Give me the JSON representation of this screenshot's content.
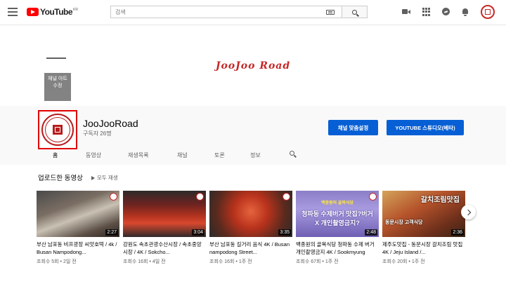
{
  "topbar": {
    "logo_text": "YouTube",
    "logo_region": "KR",
    "search_placeholder": "검색"
  },
  "banner": {
    "title": "JooJoo Road",
    "edit_art_label": "채널 아트 수정"
  },
  "channel": {
    "name": "JooJooRoad",
    "subscribers": "구독자 26명",
    "customize_button": "채널 맞춤설정",
    "studio_button": "YOUTUBE 스튜디오(베타)"
  },
  "tabs": [
    "홈",
    "동영상",
    "재생목록",
    "채널",
    "토론",
    "정보"
  ],
  "section": {
    "title": "업로드한 동영상",
    "play_all": "모두 재생"
  },
  "videos": [
    {
      "title": "부산 남포동 비프광장 씨앗호떡 / 4k / Busan Nampodong...",
      "meta": "조회수 5회 • 2일 전",
      "duration": "2:27"
    },
    {
      "title": "강원도 속초관광수산시장 / 속초중앙시장 / 4K / Sokcho...",
      "meta": "조회수 16회 • 4일 전",
      "duration": "3:04"
    },
    {
      "title": "부산 남포동 길거리 음식 4K / Busan nampodong Street...",
      "meta": "조회수 16회 • 1주 전",
      "duration": "3:35"
    },
    {
      "title": "백종원의 골목식당 청파동 수제 버거 개인촬영금지 4K / Sookmyung University...",
      "meta": "조회수 67회 • 1주 전",
      "duration": "2:48",
      "thumb_top": "백종원의 골목식당",
      "thumb_main": "청파동 수제버거 맛집?버거X 개인촬영금지?"
    },
    {
      "title": "제주도맛집 - 동문시장 갈치조림 맛집 4K / Jeju Island /...",
      "meta": "조회수 20회 • 1주 전",
      "duration": "2:36",
      "thumb_top": "갈치조림맛집",
      "thumb_main": "동문시장 고객식당"
    }
  ],
  "colors": {
    "accent": "#065fd4",
    "brand_red": "#ff0000",
    "banner_red": "#c62828"
  },
  "icons": [
    "menu-icon",
    "video-camera-icon",
    "apps-icon",
    "messages-icon",
    "notifications-icon",
    "search-icon",
    "keyboard-icon",
    "chevron-right-icon"
  ]
}
